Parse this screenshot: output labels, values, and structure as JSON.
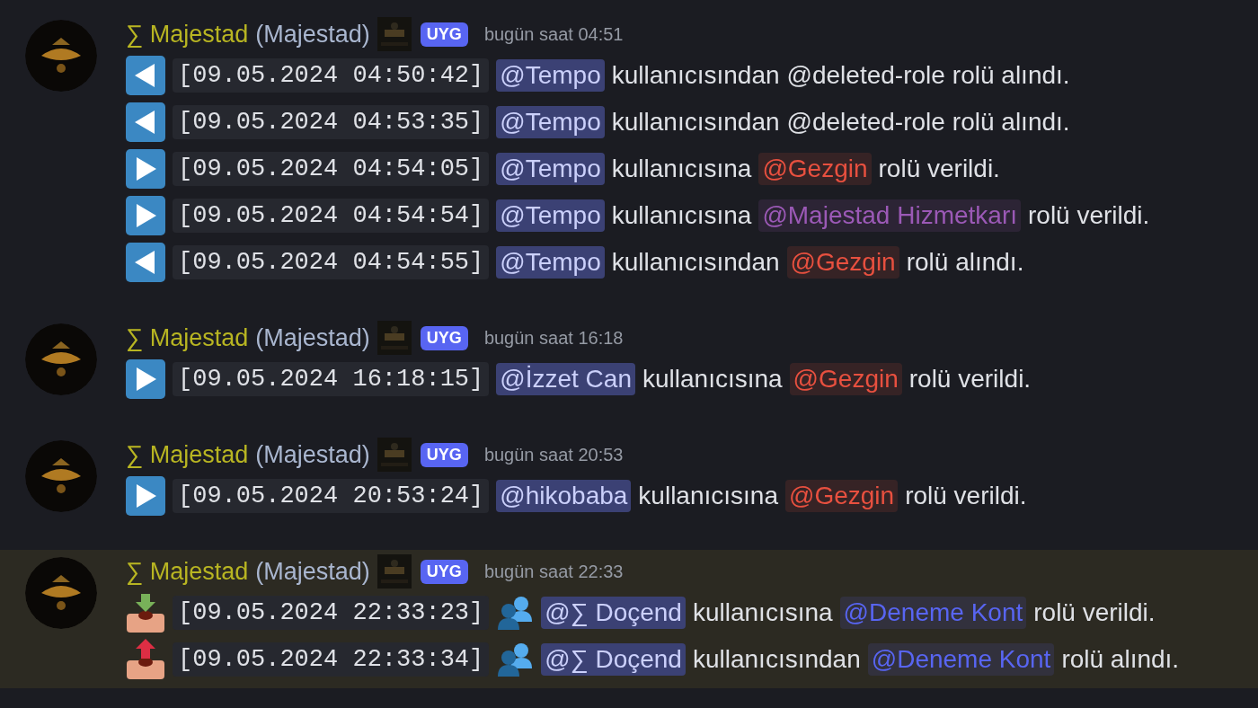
{
  "messages": [
    {
      "author": "∑ Majestad",
      "nickname": "(Majestad)",
      "tag": "UYG",
      "time": "bugün saat 04:51",
      "highlighted": false,
      "lines": [
        {
          "kind": "left",
          "stamp": "[09.05.2024 04:50:42]",
          "user": "@Tempo",
          "action": "kullanıcısından",
          "role": "@deleted-role",
          "result": "rolü alındı."
        },
        {
          "kind": "left",
          "stamp": "[09.05.2024 04:53:35]",
          "user": "@Tempo",
          "action": "kullanıcısından",
          "role": "@deleted-role",
          "result": "rolü alındı."
        },
        {
          "kind": "right",
          "stamp": "[09.05.2024 04:54:05]",
          "user": "@Tempo",
          "action": "kullanıcısına",
          "role": "@Gezgin",
          "color": "#e8503f",
          "result": "rolü verildi."
        },
        {
          "kind": "right",
          "stamp": "[09.05.2024 04:54:54]",
          "user": "@Tempo",
          "action": "kullanıcısına",
          "role": "@Majestad Hizmetkarı",
          "color": "#9b59b6",
          "result": "rolü verildi."
        },
        {
          "kind": "left",
          "stamp": "[09.05.2024 04:54:55]",
          "user": "@Tempo",
          "action": "kullanıcısından",
          "role": "@Gezgin",
          "color": "#e8503f",
          "result": "rolü alındı."
        }
      ]
    },
    {
      "author": "∑ Majestad",
      "nickname": "(Majestad)",
      "tag": "UYG",
      "time": "bugün saat 16:18",
      "highlighted": false,
      "lines": [
        {
          "kind": "right",
          "stamp": "[09.05.2024 16:18:15]",
          "user": "@İzzet Can",
          "action": "kullanıcısına",
          "role": "@Gezgin",
          "color": "#e8503f",
          "result": "rolü verildi."
        }
      ]
    },
    {
      "author": "∑ Majestad",
      "nickname": "(Majestad)",
      "tag": "UYG",
      "time": "bugün saat 20:53",
      "highlighted": false,
      "lines": [
        {
          "kind": "right",
          "stamp": "[09.05.2024 20:53:24]",
          "user": "@hikobaba",
          "action": "kullanıcısına",
          "role": "@Gezgin",
          "color": "#e8503f",
          "result": "rolü verildi."
        }
      ]
    },
    {
      "author": "∑ Majestad",
      "nickname": "(Majestad)",
      "tag": "UYG",
      "time": "bugün saat 22:33",
      "highlighted": true,
      "lines": [
        {
          "kind": "inbox_in",
          "stamp": "[09.05.2024 22:33:23]",
          "people": true,
          "user": "@∑ Doçend",
          "action": "kullanıcısına",
          "role": "@Deneme Kont",
          "color": "#5865f2",
          "result": "rolü verildi."
        },
        {
          "kind": "inbox_out",
          "stamp": "[09.05.2024 22:33:34]",
          "people": true,
          "user": "@∑ Doçend",
          "action": "kullanıcısından",
          "role": "@Deneme Kont",
          "color": "#5865f2",
          "result": "rolü alındı."
        }
      ]
    }
  ]
}
